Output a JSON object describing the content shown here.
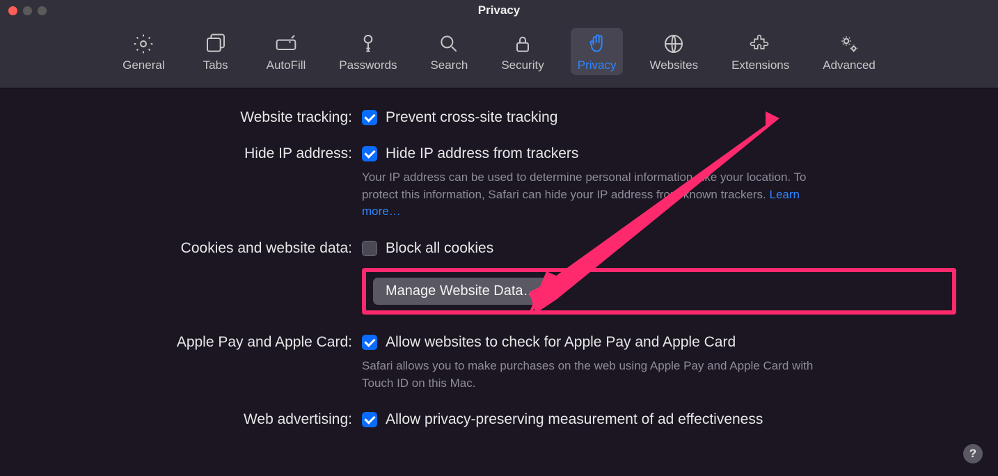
{
  "window": {
    "title": "Privacy"
  },
  "tabs": {
    "general": "General",
    "tabs": "Tabs",
    "autofill": "AutoFill",
    "passwords": "Passwords",
    "search": "Search",
    "security": "Security",
    "privacy": "Privacy",
    "websites": "Websites",
    "extensions": "Extensions",
    "advanced": "Advanced"
  },
  "sections": {
    "tracking": {
      "label": "Website tracking:",
      "option": "Prevent cross-site tracking",
      "checked": true
    },
    "hideip": {
      "label": "Hide IP address:",
      "option": "Hide IP address from trackers",
      "checked": true,
      "desc": "Your IP address can be used to determine personal information, like your location. To protect this information, Safari can hide your IP address from known trackers. ",
      "learn": "Learn more…"
    },
    "cookies": {
      "label": "Cookies and website data:",
      "option": "Block all cookies",
      "checked": false,
      "button": "Manage Website Data…"
    },
    "applepay": {
      "label": "Apple Pay and Apple Card:",
      "option": "Allow websites to check for Apple Pay and Apple Card",
      "checked": true,
      "desc": "Safari allows you to make purchases on the web using Apple Pay and Apple Card with Touch ID on this Mac."
    },
    "webadv": {
      "label": "Web advertising:",
      "option": "Allow privacy-preserving measurement of ad effectiveness",
      "checked": true
    }
  },
  "help": "?"
}
